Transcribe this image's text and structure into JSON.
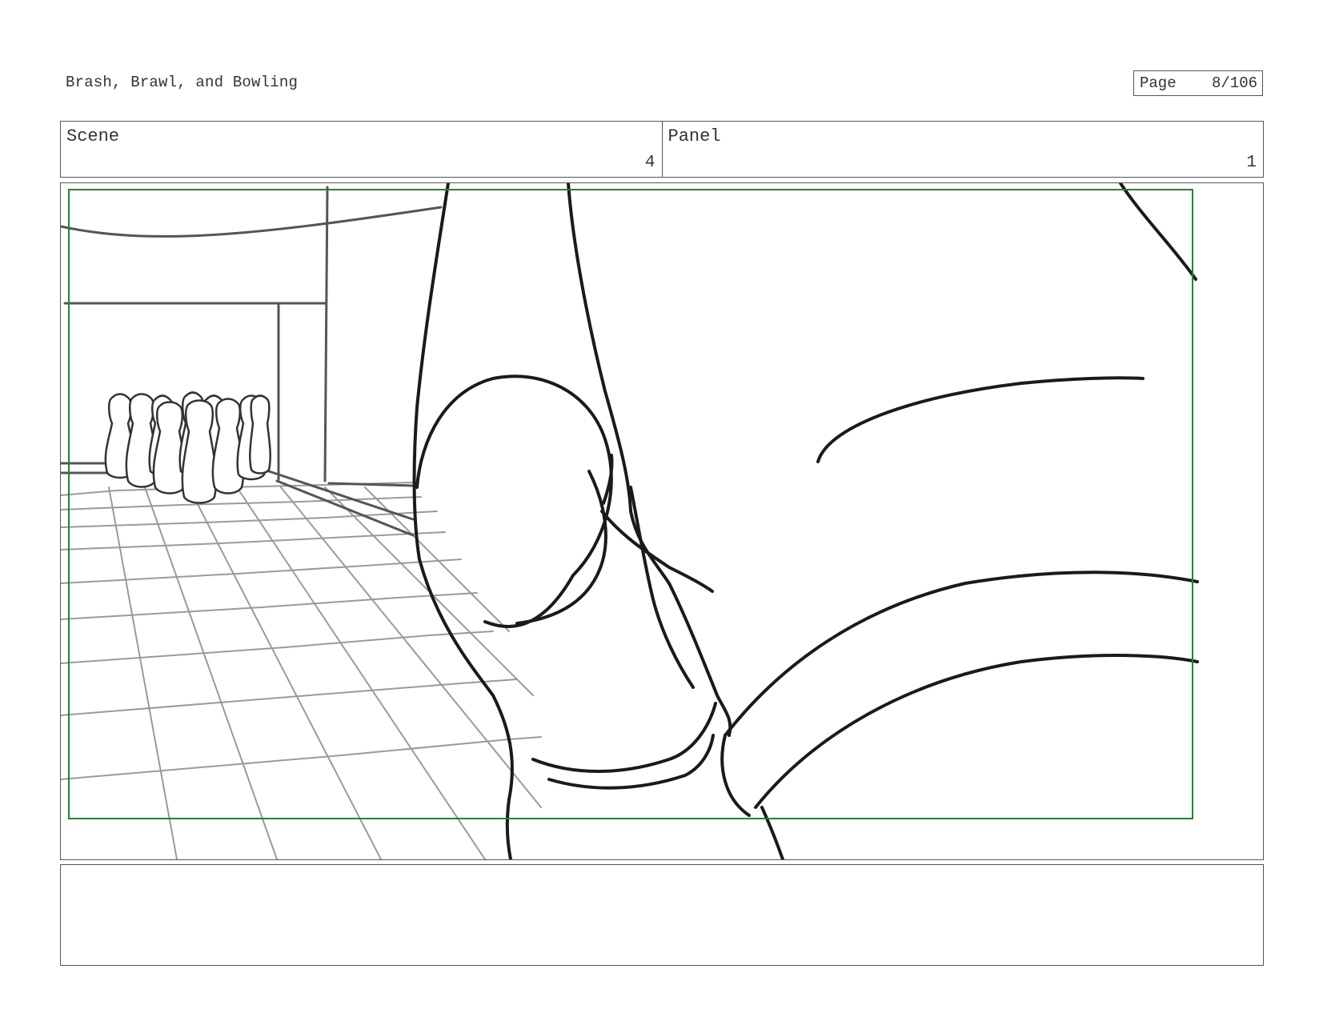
{
  "document": {
    "title": "Brash, Brawl, and Bowling",
    "page_label": "Page",
    "page_number": "8/106"
  },
  "header": {
    "scene_label": "Scene",
    "scene_number": "4",
    "panel_label": "Panel",
    "panel_number": "1"
  },
  "panel": {
    "safe_frame_color": "#2e7d32",
    "line_color": "#1a1a1a",
    "grid_color": "#9a9a9a"
  },
  "notes": {
    "text": ""
  }
}
